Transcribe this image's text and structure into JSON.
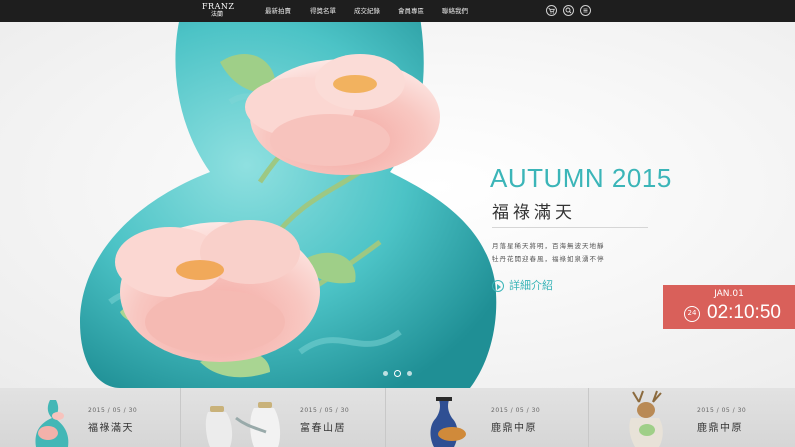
{
  "brand": {
    "name": "FRANZ",
    "sub": "法蘭"
  },
  "nav": {
    "items": [
      {
        "label": "最新拍賣"
      },
      {
        "label": "得獎名單"
      },
      {
        "label": "成交紀錄"
      },
      {
        "label": "會員專區"
      },
      {
        "label": "聯絡我們"
      }
    ]
  },
  "header_icons": [
    "cart-icon",
    "search-icon",
    "menu-icon"
  ],
  "hero": {
    "season": "AUTUMN 2015",
    "title": "福祿滿天",
    "description_lines": [
      "月落星稀天將明，百海無波天地靜",
      "牡丹花開迎春風，福祿如泉湧不停"
    ],
    "more_label": "詳細介紹",
    "slide_count": 3,
    "active_slide": 2
  },
  "countdown": {
    "date": "JAN.01",
    "hours_label": "24",
    "time": "02:10:50",
    "color": "#d9605a"
  },
  "cards": [
    {
      "date": "2015 / 05 / 30",
      "title": "福祿滿天"
    },
    {
      "date": "2015 / 05 / 30",
      "title": "富春山居"
    },
    {
      "date": "2015 / 05 / 30",
      "title": "鹿鼎中原"
    },
    {
      "date": "2015 / 05 / 30",
      "title": "鹿鼎中原"
    }
  ],
  "colors": {
    "accent": "#3bb5b8",
    "countdown": "#d9605a",
    "topbar": "#1e1e1e"
  }
}
